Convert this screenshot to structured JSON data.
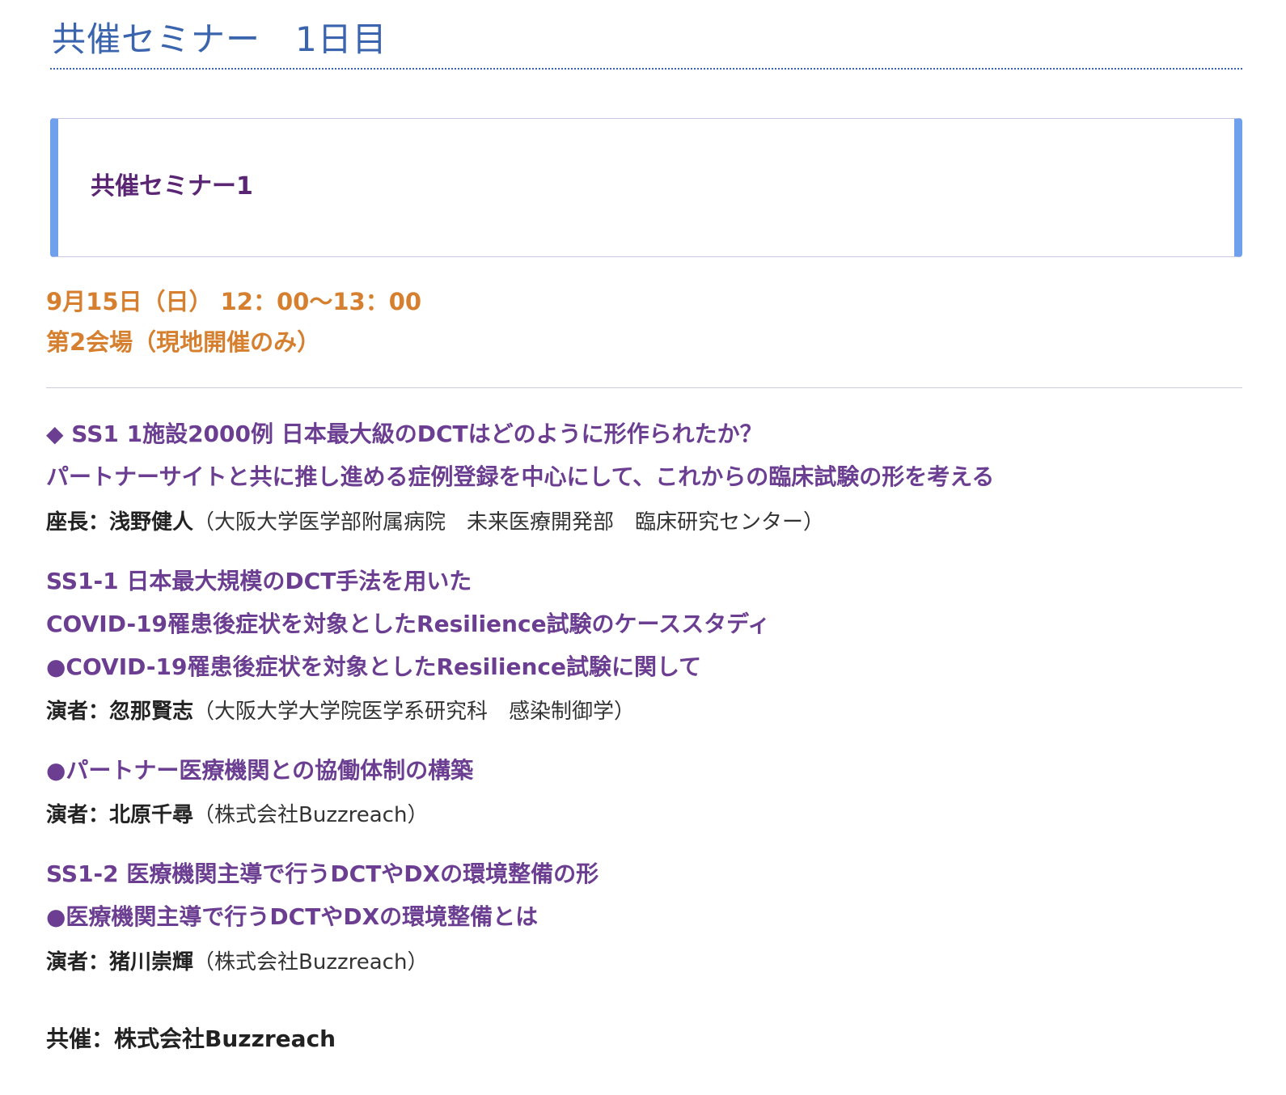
{
  "page_title": "共催セミナー　1日目",
  "session": {
    "name": "共催セミナー1",
    "datetime": "9月15日（日）  12：00〜13：00",
    "venue": "第2会場（現地開催のみ）"
  },
  "program": {
    "ss1_title_line1": "◆ SS1  1施設2000例 日本最大級のDCTはどのように形作られたか？",
    "ss1_title_line2": "パートナーサイトと共に推し進める症例登録を中心にして、これからの臨床試験の形を考える",
    "chair": {
      "role": "座長：浅野健人",
      "affiliation": "（大阪大学医学部附属病院　未来医療開発部　臨床研究センター）"
    },
    "ss1_1": {
      "title_line1": "SS1-1  日本最大規模のDCT手法を用いた",
      "title_line2": "COVID-19罹患後症状を対象としたResilience試験のケーススタディ",
      "topic1": "●COVID-19罹患後症状を対象としたResilience試験に関して",
      "speaker1": {
        "role": "演者：忽那賢志",
        "affiliation": "（大阪大学大学院医学系研究科　感染制御学）"
      },
      "topic2": "●パートナー医療機関との協働体制の構築",
      "speaker2": {
        "role": "演者：北原千尋",
        "affiliation": "（株式会社Buzzreach）"
      }
    },
    "ss1_2": {
      "title_line1": "SS1-2  医療機関主導で行うDCTやDXの環境整備の形",
      "topic1": "●医療機関主導で行うDCTやDXの環境整備とは",
      "speaker1": {
        "role": "演者：猪川崇輝",
        "affiliation": "（株式会社Buzzreach）"
      }
    },
    "cosponsor": "共催：株式会社Buzzreach"
  },
  "colors": {
    "title_blue": "#3a64ad",
    "accent_purple": "#6b3e92",
    "session_purple": "#5a2674",
    "orange": "#d6802f",
    "box_border_blue": "#6fa0ec"
  }
}
